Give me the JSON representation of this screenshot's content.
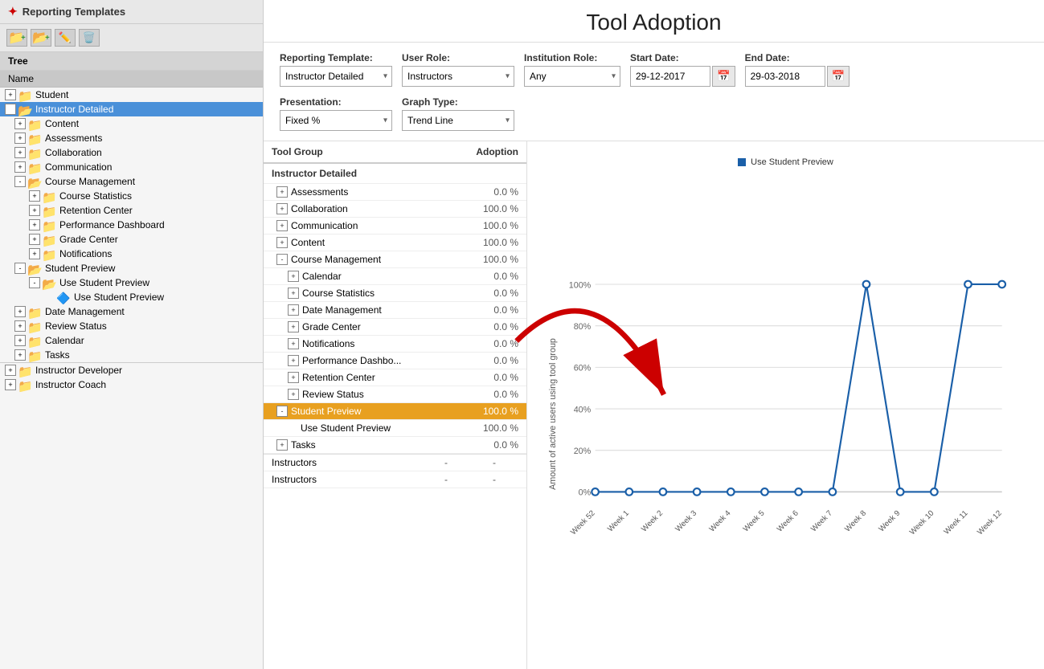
{
  "page": {
    "title": "Tool Adoption"
  },
  "sidebar": {
    "header": "Reporting Templates",
    "tree_label": "Tree",
    "name_label": "Name",
    "items": [
      {
        "id": "student",
        "label": "Student",
        "level": 0,
        "expanded": false,
        "icon": "folder-orange"
      },
      {
        "id": "instructor-detailed",
        "label": "Instructor Detailed",
        "level": 0,
        "expanded": true,
        "selected": true,
        "icon": "folder-orange"
      },
      {
        "id": "content",
        "label": "Content",
        "level": 1,
        "expanded": false,
        "icon": "folder-orange"
      },
      {
        "id": "assessments-tree",
        "label": "Assessments",
        "level": 1,
        "expanded": false,
        "icon": "folder-orange"
      },
      {
        "id": "collaboration-tree",
        "label": "Collaboration",
        "level": 1,
        "expanded": false,
        "icon": "folder-orange"
      },
      {
        "id": "communication-tree",
        "label": "Communication",
        "level": 1,
        "expanded": false,
        "icon": "folder-orange"
      },
      {
        "id": "course-management",
        "label": "Course Management",
        "level": 1,
        "expanded": true,
        "icon": "folder-orange"
      },
      {
        "id": "course-statistics",
        "label": "Course Statistics",
        "level": 2,
        "expanded": false,
        "icon": "folder-orange"
      },
      {
        "id": "retention-center-tree",
        "label": "Retention Center",
        "level": 2,
        "expanded": false,
        "icon": "folder-orange"
      },
      {
        "id": "performance-dashboard",
        "label": "Performance Dashboard",
        "level": 2,
        "expanded": false,
        "icon": "folder-orange"
      },
      {
        "id": "grade-center",
        "label": "Grade Center",
        "level": 2,
        "expanded": false,
        "icon": "folder-orange"
      },
      {
        "id": "notifications",
        "label": "Notifications",
        "level": 2,
        "expanded": false,
        "icon": "folder-orange"
      },
      {
        "id": "student-preview-parent",
        "label": "Student Preview",
        "level": 1,
        "expanded": true,
        "icon": "folder-orange"
      },
      {
        "id": "use-student-preview-parent",
        "label": "Use Student Preview",
        "level": 2,
        "expanded": true,
        "icon": "folder-orange"
      },
      {
        "id": "use-student-preview-leaf",
        "label": "Use Student Preview",
        "level": 3,
        "expanded": false,
        "icon": "folder-blue",
        "leaf": true
      },
      {
        "id": "date-management",
        "label": "Date Management",
        "level": 1,
        "expanded": false,
        "icon": "folder-orange"
      },
      {
        "id": "review-status",
        "label": "Review Status",
        "level": 1,
        "expanded": false,
        "icon": "folder-orange"
      },
      {
        "id": "calendar",
        "label": "Calendar",
        "level": 1,
        "expanded": false,
        "icon": "folder-orange"
      },
      {
        "id": "tasks",
        "label": "Tasks",
        "level": 1,
        "expanded": false,
        "icon": "folder-orange"
      },
      {
        "id": "instructor-developer",
        "label": "Instructor Developer",
        "level": 0,
        "expanded": false,
        "icon": "folder-orange"
      },
      {
        "id": "instructor-coach",
        "label": "Instructor Coach",
        "level": 0,
        "expanded": false,
        "icon": "folder-orange"
      }
    ]
  },
  "form": {
    "reporting_template_label": "Reporting Template:",
    "reporting_template_value": "Instructor Detailed",
    "user_role_label": "User Role:",
    "user_role_value": "Instructors",
    "institution_role_label": "Institution Role:",
    "institution_role_value": "Any",
    "start_date_label": "Start Date:",
    "start_date_value": "29-12-2017",
    "end_date_label": "End Date:",
    "end_date_value": "29-03-2018",
    "presentation_label": "Presentation:",
    "presentation_value": "Fixed %",
    "graph_type_label": "Graph Type:",
    "graph_type_value": "Trend Line"
  },
  "table": {
    "col_tool_group": "Tool Group",
    "col_adoption": "Adoption",
    "group_header": "Instructor Detailed",
    "rows": [
      {
        "label": "Assessments",
        "adoption": "0.0 %",
        "indent": 1,
        "expandable": true
      },
      {
        "label": "Collaboration",
        "adoption": "100.0 %",
        "indent": 1,
        "expandable": true
      },
      {
        "label": "Communication",
        "adoption": "100.0 %",
        "indent": 1,
        "expandable": true
      },
      {
        "label": "Content",
        "adoption": "100.0 %",
        "indent": 1,
        "expandable": true
      },
      {
        "label": "Course Management",
        "adoption": "100.0 %",
        "indent": 1,
        "expandable": true
      },
      {
        "label": "Calendar",
        "adoption": "0.0 %",
        "indent": 2,
        "expandable": true
      },
      {
        "label": "Course Statistics",
        "adoption": "0.0 %",
        "indent": 2,
        "expandable": true
      },
      {
        "label": "Date Management",
        "adoption": "0.0 %",
        "indent": 2,
        "expandable": true
      },
      {
        "label": "Grade Center",
        "adoption": "0.0 %",
        "indent": 2,
        "expandable": true
      },
      {
        "label": "Notifications",
        "adoption": "0.0 %",
        "indent": 2,
        "expandable": true
      },
      {
        "label": "Performance Dashbo...",
        "adoption": "0.0 %",
        "indent": 2,
        "expandable": true
      },
      {
        "label": "Retention Center",
        "adoption": "0.0 %",
        "indent": 2,
        "expandable": true
      },
      {
        "label": "Review Status",
        "adoption": "0.0 %",
        "indent": 2,
        "expandable": true
      },
      {
        "label": "Student Preview",
        "adoption": "100.0 %",
        "indent": 1,
        "expandable": true,
        "selected": true
      },
      {
        "label": "Use Student Preview",
        "adoption": "100.0 %",
        "indent": 2,
        "expandable": false
      },
      {
        "label": "Tasks",
        "adoption": "0.0 %",
        "indent": 1,
        "expandable": true
      }
    ],
    "bottom_rows": [
      {
        "label": "Instructors",
        "val1": "-",
        "val2": "-"
      },
      {
        "label": "Instructors",
        "val1": "-",
        "val2": "-"
      }
    ]
  },
  "chart": {
    "legend_label": "Use Student Preview",
    "y_axis_label": "Amount of active users using tool group",
    "y_labels": [
      "0%",
      "20%",
      "40%",
      "60%",
      "80%",
      "100%"
    ],
    "x_labels": [
      "Week 52",
      "Week 1",
      "Week 2",
      "Week 3",
      "Week 4",
      "Week 5",
      "Week 6",
      "Week 7",
      "Week 8",
      "Week 9",
      "Week 10",
      "Week 11",
      "Week 12"
    ],
    "data_points": [
      0,
      0,
      0,
      0,
      0,
      0,
      0,
      0,
      100,
      0,
      0,
      100,
      100
    ]
  }
}
